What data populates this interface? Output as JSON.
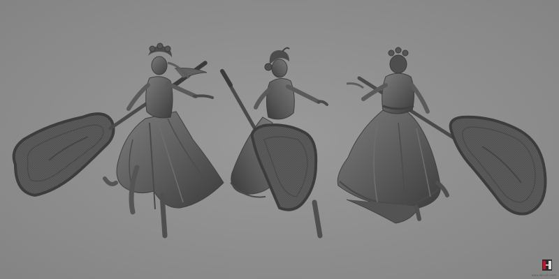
{
  "scene": {
    "subject": "sculpt-turnaround",
    "views": [
      "front",
      "side",
      "back"
    ],
    "colors": {
      "background": "#8d8d8d",
      "material": "#5e5e5e",
      "material_dark": "#3a3a3a",
      "material_light": "#7a7a7a",
      "logo_red": "#c8102e"
    }
  },
  "watermark": {
    "text": "www.zbrush.com",
    "icon": "zbrush-logo-icon"
  }
}
